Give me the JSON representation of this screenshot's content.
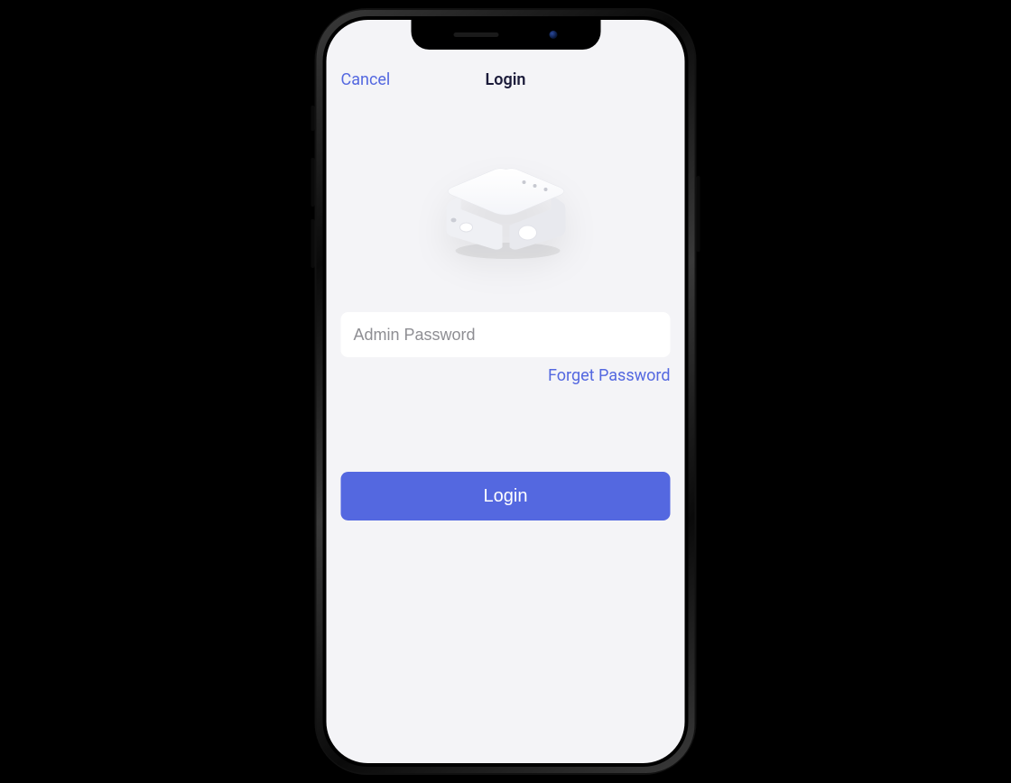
{
  "colors": {
    "accent": "#5468E0",
    "text_primary": "#1B1B3A",
    "placeholder": "#8E8E93",
    "app_background": "#F4F4F7",
    "page_background": "#000000",
    "button_text": "#FFFFFF",
    "input_background": "#FFFFFF"
  },
  "nav": {
    "cancel_label": "Cancel",
    "title": "Login"
  },
  "hero": {
    "device_icon_name": "router-device-icon"
  },
  "form": {
    "password_value": "",
    "password_placeholder": "Admin Password",
    "forgot_label": "Forget Password"
  },
  "actions": {
    "login_label": "Login"
  }
}
